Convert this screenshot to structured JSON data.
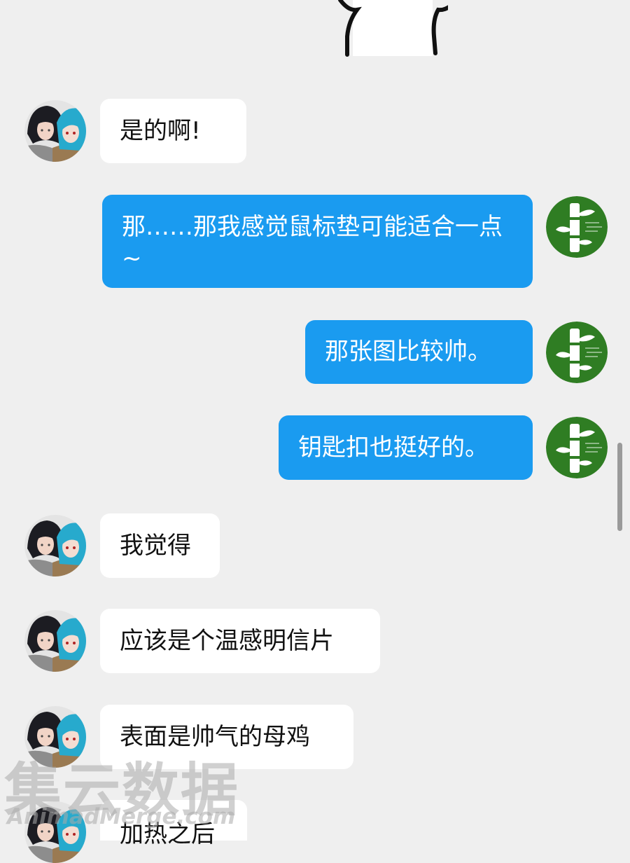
{
  "messages": [
    {
      "side": "in",
      "text": "是的啊!"
    },
    {
      "side": "out",
      "text": "那……那我感觉鼠标垫可能适合一点~"
    },
    {
      "side": "out",
      "text": "那张图比较帅。"
    },
    {
      "side": "out",
      "text": "钥匙扣也挺好的。"
    },
    {
      "side": "in",
      "text": "我觉得"
    },
    {
      "side": "in",
      "text": "应该是个温感明信片"
    },
    {
      "side": "in",
      "text": "表面是帅气的母鸡"
    },
    {
      "side": "in",
      "text": "加热之后"
    }
  ],
  "watermark": {
    "title": "集云数据",
    "subtitle": "AnimadMerge.com"
  },
  "colors": {
    "background": "#efefef",
    "outgoing_bubble": "#1a9bf0",
    "incoming_bubble": "#ffffff",
    "bamboo_avatar": "#2f7d23"
  },
  "icons": {
    "incoming_avatar": "anime-couple-avatar",
    "outgoing_avatar": "bamboo-avatar",
    "sticker": "cartoon-sticker-partial"
  }
}
